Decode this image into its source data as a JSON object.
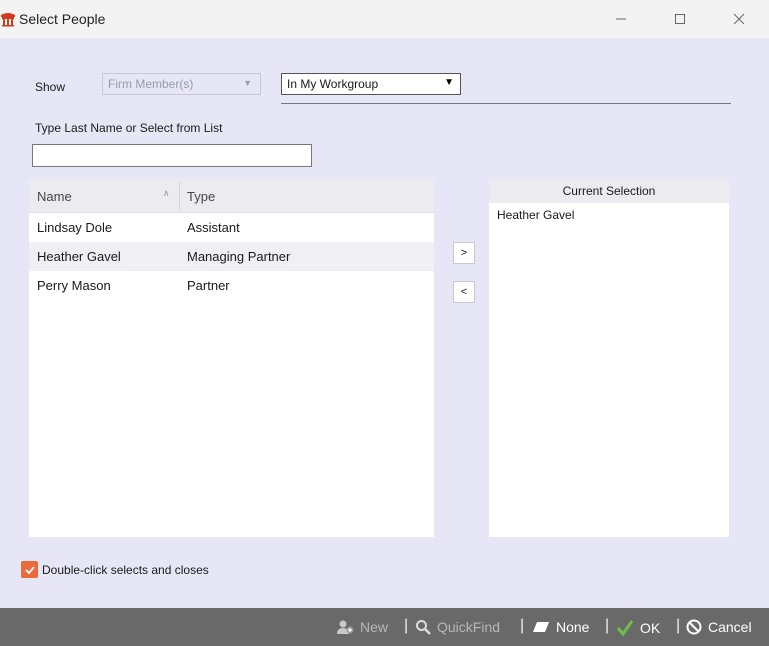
{
  "window": {
    "title": "Select People"
  },
  "filters": {
    "show_label": "Show",
    "member_type": "Firm Member(s)",
    "scope": "In My Workgroup"
  },
  "search": {
    "label": "Type Last Name or Select from List",
    "value": ""
  },
  "people_list": {
    "columns": [
      "Name",
      "Type"
    ],
    "rows": [
      {
        "name": "Lindsay Dole",
        "type": "Assistant"
      },
      {
        "name": "Heather Gavel",
        "type": "Managing Partner"
      },
      {
        "name": "Perry Mason",
        "type": "Partner"
      }
    ]
  },
  "move_buttons": {
    "add": ">",
    "remove": "<"
  },
  "current_selection": {
    "header": "Current Selection",
    "items": [
      "Heather Gavel"
    ]
  },
  "options": {
    "double_click_label": "Double-click selects and closes",
    "double_click_checked": true
  },
  "footer": {
    "new": "New",
    "quickfind": "QuickFind",
    "none": "None",
    "ok": "OK",
    "cancel": "Cancel"
  },
  "colors": {
    "accent": "#e96a3a",
    "background": "#e6e6f6",
    "footer": "#696969",
    "ok_check": "#6cc04a"
  }
}
